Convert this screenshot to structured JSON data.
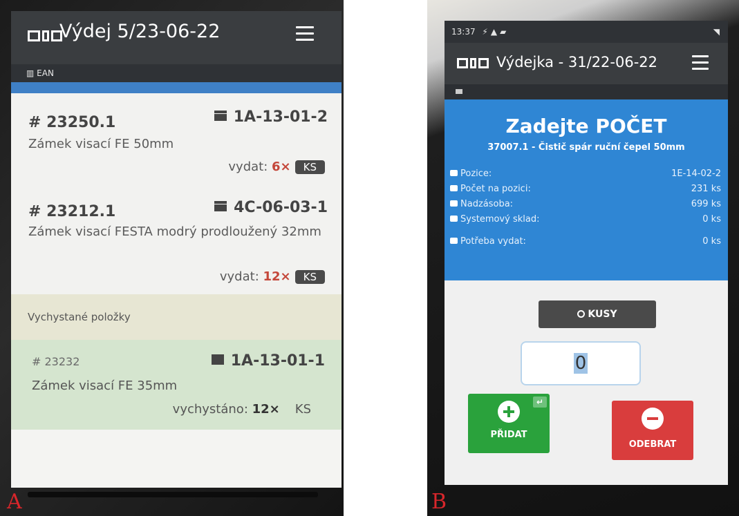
{
  "panels": {
    "a_letter": "A",
    "b_letter": "B"
  },
  "screen_a": {
    "title": "Výdej 5/23-06-22",
    "ean_label": "EAN",
    "items": [
      {
        "number": "# 23250.1",
        "location": "1A-13-01-2",
        "name": "Zámek visací FE 50mm",
        "issue_prefix": "vydat:",
        "qty": "6×",
        "unit": "KS"
      },
      {
        "number": "# 23212.1",
        "location": "4C-06-03-1",
        "name": "Zámek visací FESTA modrý prodloužený 32mm",
        "issue_prefix": "vydat:",
        "qty": "12×",
        "unit": "KS"
      }
    ],
    "section_label": "Vychystané položky",
    "done_item": {
      "number": "# 23232",
      "location": "1A-13-01-1",
      "name": "Zámek visací FE 35mm",
      "status_prefix": "vychystáno:",
      "qty": "12×",
      "unit": "KS"
    }
  },
  "screen_b": {
    "status_time": "13:37",
    "title": "Výdejka - 31/22-06-22",
    "heading": "Zadejte POČET",
    "product": "37007.1 - Čistič spár ruční čepel 50mm",
    "rows": [
      {
        "label": "Pozice:",
        "value": "1E-14-02-2"
      },
      {
        "label": "Počet na pozici:",
        "value": "231 ks"
      },
      {
        "label": "Nadzásoba:",
        "value": "699 ks"
      },
      {
        "label": "Systemový sklad:",
        "value": "0 ks"
      },
      {
        "label": "Potřeba vydat:",
        "value": "0 ks"
      }
    ],
    "unit_button": "KUSY",
    "quantity": "0",
    "add_button": "PŘIDAT",
    "remove_button": "ODEBRAT"
  }
}
